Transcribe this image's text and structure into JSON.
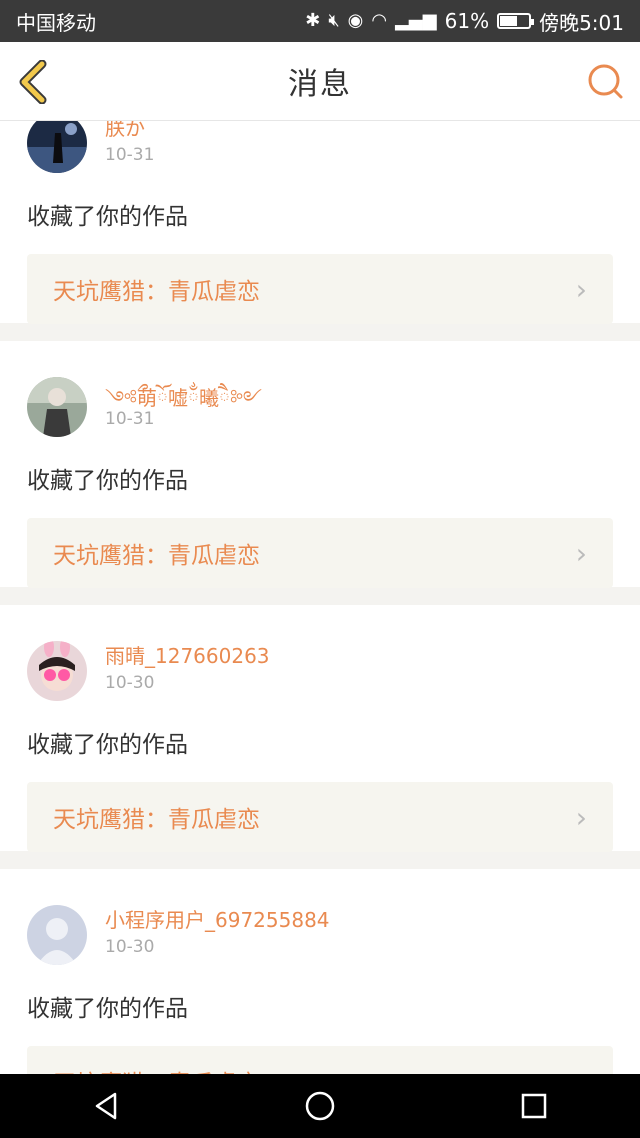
{
  "status_bar": {
    "carrier": "中国移动",
    "battery_percent": "61%",
    "time": "傍晚5:01",
    "battery_level": 0.61,
    "network": "4G"
  },
  "header": {
    "title": "消息",
    "accent_color": "#e98a50"
  },
  "messages": [
    {
      "username": "朕か",
      "date": "10-31",
      "action": "收藏了你的作品",
      "work": "天坑鹰猎：青瓜虐恋",
      "avatar": "night-photo-avatar"
    },
    {
      "username": "༺ྀ萌ོ嘘ྂ曦ཻ༻",
      "date": "10-31",
      "action": "收藏了你的作品",
      "work": "天坑鹰猎：青瓜虐恋",
      "avatar": "girl-photo-avatar"
    },
    {
      "username": "雨晴_127660263",
      "date": "10-30",
      "action": "收藏了你的作品",
      "work": "天坑鹰猎：青瓜虐恋",
      "avatar": "bunny-girl-avatar"
    },
    {
      "username": "小程序用户_697255884",
      "date": "10-30",
      "action": "收藏了你的作品",
      "work": "天坑鹰猎：青瓜虐恋",
      "avatar": "default-user-avatar"
    }
  ]
}
